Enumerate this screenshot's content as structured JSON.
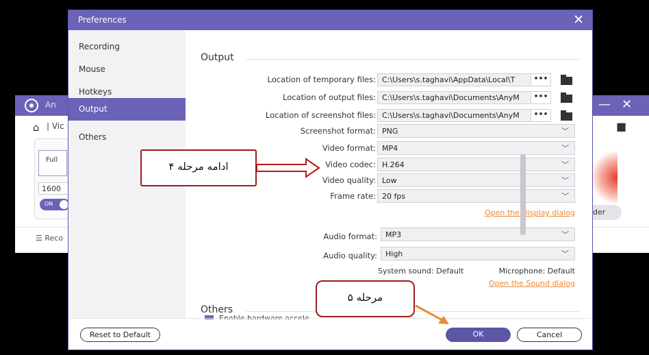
{
  "background_app": {
    "name": "An",
    "nav_text": "| Vic",
    "full_label": "Full",
    "resolution": "1600",
    "toggle_label": "ON",
    "record_label": "Reco",
    "pill_label": "der"
  },
  "dialog": {
    "title": "Preferences",
    "sidebar": [
      {
        "label": "Recording"
      },
      {
        "label": "Mouse"
      },
      {
        "label": "Hotkeys"
      },
      {
        "label": "Output",
        "active": true
      },
      {
        "label": "Others"
      }
    ],
    "output": {
      "heading": "Output",
      "temp_label": "Location of temporary files:",
      "temp_path": "C:\\Users\\s.taghavi\\AppData\\Local\\T",
      "output_label": "Location of output files:",
      "output_path": "C:\\Users\\s.taghavi\\Documents\\AnyM",
      "screenshot_loc_label": "Location of screenshot files:",
      "screenshot_path": "C:\\Users\\s.taghavi\\Documents\\AnyM",
      "browse_label": "•••",
      "screenshot_format_label": "Screenshot format:",
      "screenshot_format": "PNG",
      "video_format_label": "Video format:",
      "video_format": "MP4",
      "video_codec_label": "Video codec:",
      "video_codec": "H.264",
      "video_quality_label": "Video quality:",
      "video_quality": "Low",
      "frame_rate_label": "Frame rate:",
      "frame_rate": "20 fps",
      "display_link": "Open the Display dialog",
      "audio_format_label": "Audio format:",
      "audio_format": "MP3",
      "audio_quality_label": "Audio quality:",
      "audio_quality": "High",
      "system_sound": "System sound: Default",
      "microphone": "Microphone: Default",
      "sound_link": "Open the Sound dialog"
    },
    "others": {
      "heading": "Others",
      "hardware_accel": "Enable hardware accele"
    },
    "buttons": {
      "reset": "Reset to Default",
      "ok": "OK",
      "cancel": "Cancel"
    }
  },
  "annotations": {
    "callout_step4": "ادامه مرحله ۴",
    "callout_step5": "مرحله ۵",
    "arrow_color": "#b01818",
    "arrow2_color": "#e88a36"
  },
  "icons": [
    "close-icon",
    "folder-icon",
    "chevron-down-icon",
    "home-icon",
    "camera-icon",
    "record-logo-icon"
  ],
  "colors": {
    "accent": "#6a63b8",
    "link": "#e88a36"
  }
}
